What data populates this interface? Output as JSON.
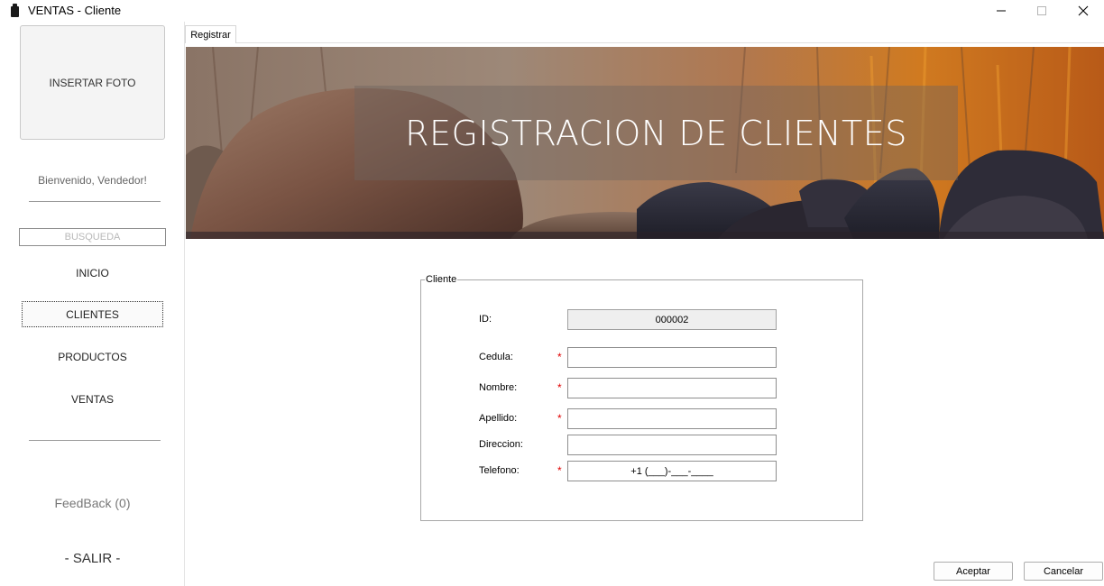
{
  "window": {
    "title": "VENTAS - Cliente"
  },
  "sidebar": {
    "photo_label": "INSERTAR FOTO",
    "welcome": "Bienvenido, Vendedor!",
    "search_placeholder": "BUSQUEDA",
    "nav": [
      {
        "label": "INICIO"
      },
      {
        "label": "CLIENTES",
        "active": true
      },
      {
        "label": "PRODUCTOS"
      },
      {
        "label": "VENTAS"
      }
    ],
    "feedback": "FeedBack (0)",
    "exit": "- SALIR -"
  },
  "tabs": [
    {
      "label": "Registrar"
    }
  ],
  "banner": {
    "title": "REGISTRACION DE CLIENTES"
  },
  "form": {
    "group_title": "Cliente",
    "fields": {
      "id": {
        "label": "ID:",
        "value": "000002"
      },
      "cedula": {
        "label": "Cedula:",
        "value": "",
        "required_mark": "*"
      },
      "nombre": {
        "label": "Nombre:",
        "value": "",
        "required_mark": "*"
      },
      "apellido": {
        "label": "Apellido:",
        "value": "",
        "required_mark": "*"
      },
      "direccion": {
        "label": "Direccion:",
        "value": ""
      },
      "telefono": {
        "label": "Telefono:",
        "value": "+1 (___)-___-____",
        "required_mark": "*"
      }
    }
  },
  "buttons": {
    "accept": "Aceptar",
    "cancel": "Cancelar"
  },
  "colors": {
    "required": "#e00000",
    "banner_overlay": "#6e645f"
  }
}
